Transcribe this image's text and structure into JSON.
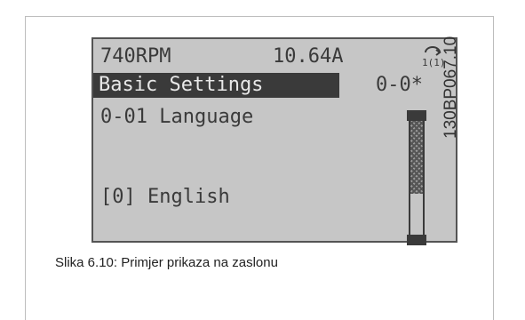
{
  "display": {
    "status": {
      "speed": "740RPM",
      "current": "10.64A",
      "mode_icon": "hand-on-remote-icon",
      "mode_icon_text": "1(1)"
    },
    "title": {
      "label": "Basic Settings",
      "number": "0-0*"
    },
    "parameter": {
      "name": "0-01 Language",
      "value": "[0] English"
    },
    "scrollbar": {
      "position": 0.0,
      "visible_fraction": 0.64
    }
  },
  "figure_code": "130BP067.10",
  "caption": "Slika 6.10: Primjer prikaza na zaslonu"
}
